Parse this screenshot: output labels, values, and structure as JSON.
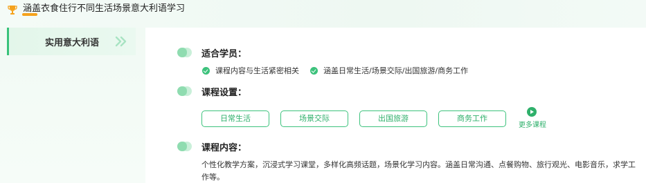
{
  "header": {
    "title": "涵盖衣食住行不同生活场景意大利语学习",
    "icon": "trophy-icon",
    "accent_color": "#f5a21c"
  },
  "sidebar": {
    "items": [
      {
        "label": "实用意大利语",
        "icon": "double-chevron-right-icon",
        "active": true
      }
    ]
  },
  "main": {
    "audience": {
      "title": "适合学员：",
      "points": [
        "课程内容与生活紧密相关",
        "涵盖日常生活/场景交际/出国旅游/商务工作"
      ]
    },
    "settings": {
      "title": "课程设置：",
      "categories": [
        "日常生活",
        "场景交际",
        "出国旅游",
        "商务工作"
      ],
      "more_label": "更多课程",
      "more_icon": "play-icon"
    },
    "content": {
      "title": "课程内容：",
      "text": "个性化教学方案，沉浸式学习课堂，多样化高频话题，场景化学习内容。涵盖日常沟通、点餐购物、旅行观光、电影音乐，求学工作等。"
    }
  },
  "colors": {
    "primary_green": "#3cc27c",
    "text_green": "#2fb06b",
    "sidebar_bg": "#f1faf4"
  }
}
